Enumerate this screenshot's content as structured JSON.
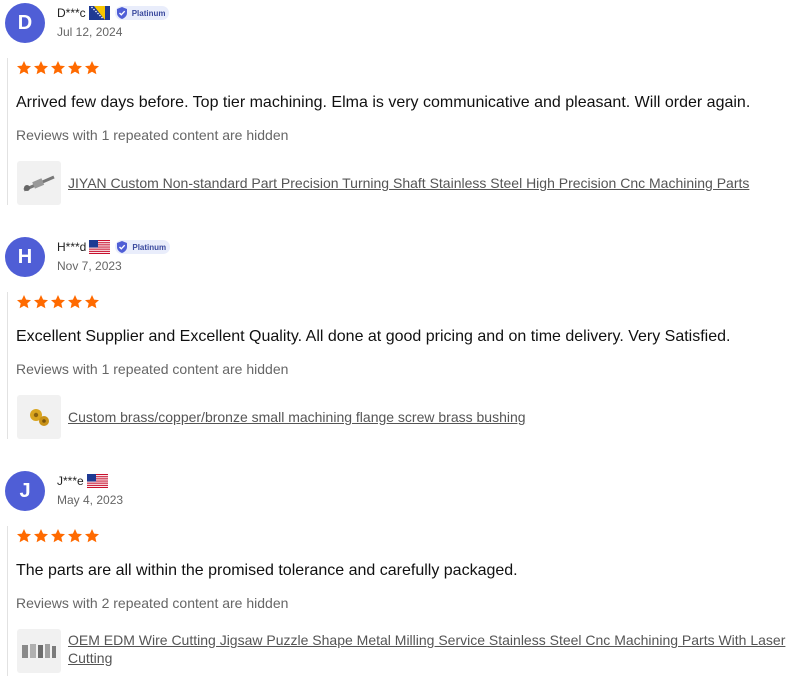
{
  "reviews": [
    {
      "initial": "D",
      "username": "D***c",
      "flag_icon": "bosnia-flag-icon",
      "badge": "Platinum",
      "date": "Jul 12, 2024",
      "rating": 5,
      "text": "Arrived few days before. Top tier machining. Elma is very communicative and pleasant. Will order again.",
      "hidden_note": "Reviews with 1 repeated content are hidden",
      "product_title": "JIYAN Custom Non-standard Part Precision Turning Shaft Stainless Steel High Precision Cnc Machining Parts"
    },
    {
      "initial": "H",
      "username": "H***d",
      "flag_icon": "usa-flag-icon",
      "badge": "Platinum",
      "date": "Nov 7, 2023",
      "rating": 5,
      "text": "Excellent Supplier and Excellent Quality. All done at good pricing and on time delivery. Very Satisfied.",
      "hidden_note": "Reviews with 1 repeated content are hidden",
      "product_title": "Custom brass/copper/bronze small machining flange screw brass bushing"
    },
    {
      "initial": "J",
      "username": "J***e",
      "flag_icon": "usa-flag-icon",
      "badge": "",
      "date": "May 4, 2023",
      "rating": 5,
      "text": "The parts are all within the promised tolerance and carefully packaged.",
      "hidden_note": "Reviews with 2 repeated content are hidden",
      "product_title": "OEM EDM Wire Cutting Jigsaw Puzzle Shape Metal Milling Service Stainless Steel Cnc Machining Parts With Laser Cutting"
    }
  ],
  "colors": {
    "avatar": "#4f5ed6",
    "star": "#ff6a00",
    "badge_bg": "#e9edfb",
    "badge_text": "#3b4a9e"
  }
}
